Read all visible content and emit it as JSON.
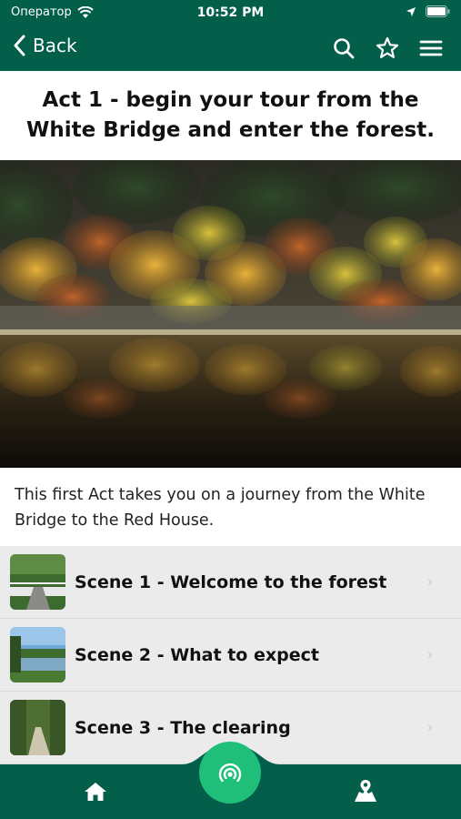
{
  "status_bar": {
    "carrier": "Оператор",
    "time": "10:52 PM"
  },
  "nav": {
    "back_label": "Back",
    "search_icon": "search-icon",
    "favorite_icon": "star-icon",
    "menu_icon": "menu-icon"
  },
  "act": {
    "title": "Act 1 - begin your tour from the White Bridge and enter the forest.",
    "description": "This first Act takes you on a journey from the White Bridge to the Red House."
  },
  "scenes": [
    {
      "label": "Scene 1 - Welcome to the forest"
    },
    {
      "label": "Scene 2 - What to expect"
    },
    {
      "label": "Scene 3 - The clearing"
    }
  ],
  "tab_bar": {
    "home_icon": "home-icon",
    "center_icon": "audio-broadcast-icon",
    "map_icon": "map-pin-icon"
  },
  "colors": {
    "brand": "#035e4a",
    "accent": "#1fbf7a",
    "list_bg": "#ebebeb"
  }
}
